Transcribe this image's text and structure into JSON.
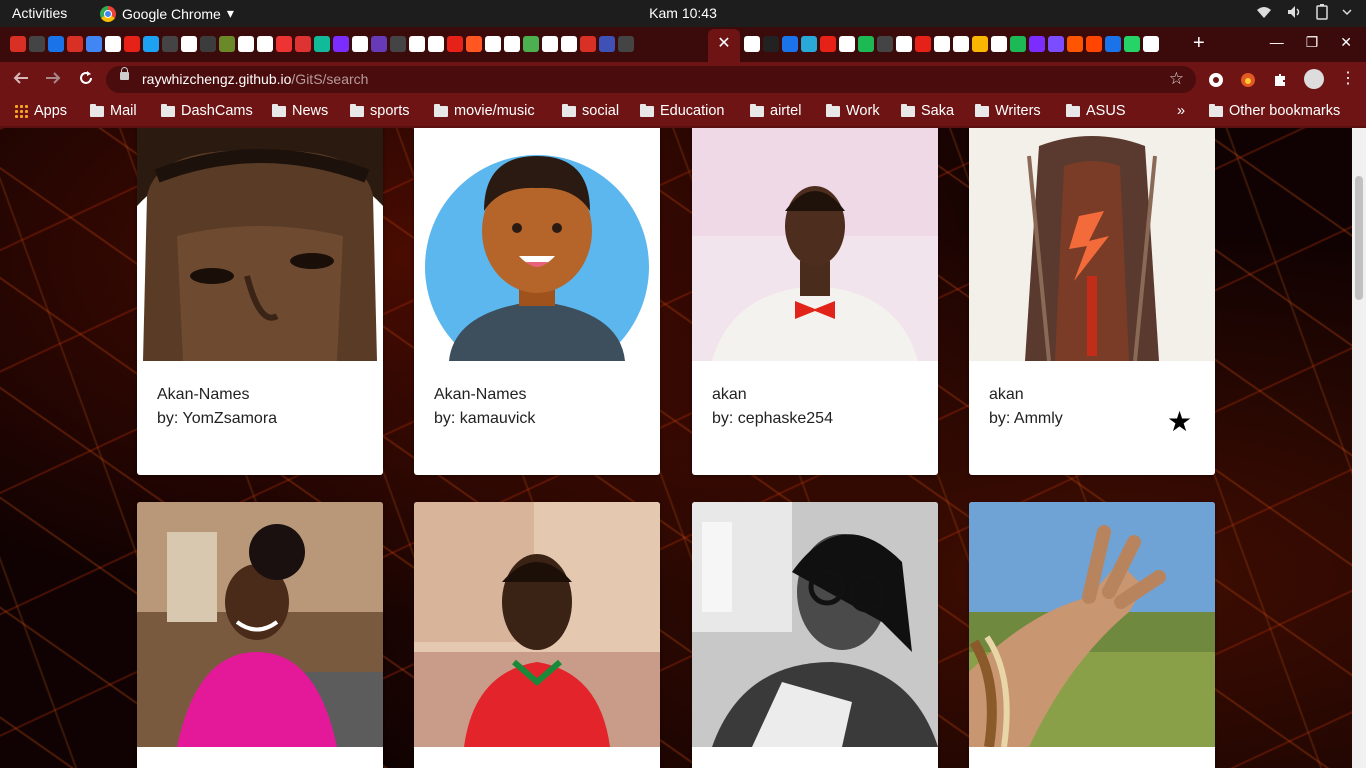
{
  "system_bar": {
    "activities": "Activities",
    "app_name": "Google Chrome",
    "dropdown_glyph": "▾",
    "clock": "Kam 10:43"
  },
  "browser": {
    "active_tab_close": "✕",
    "new_tab": "+",
    "url_host": "raywhizchengz.github.io",
    "url_path": "/GitS/search",
    "window_controls": [
      "—",
      "❐",
      "✕"
    ]
  },
  "bookmarks": {
    "apps_label": "Apps",
    "items": [
      "Mail",
      "DashCams",
      "News",
      "sports",
      "movie/music",
      "social",
      "Education",
      "airtel",
      "Work",
      "Saka",
      "Writers",
      "ASUS"
    ],
    "overflow": "»",
    "other": "Other bookmarks"
  },
  "results": [
    {
      "title": "Akan-Names",
      "author": "by: YomZsamora",
      "starred": false
    },
    {
      "title": "Akan-Names",
      "author": "by: kamauvick",
      "starred": false
    },
    {
      "title": "akan",
      "author": "by: cephaske254",
      "starred": false
    },
    {
      "title": "akan",
      "author": "by: Ammly",
      "starred": true,
      "star_glyph": "★"
    }
  ],
  "colors": {
    "tabstrip": "#3b0a0a",
    "toolbar": "#6e1414",
    "card": "#ffffff",
    "background": "#100202"
  }
}
